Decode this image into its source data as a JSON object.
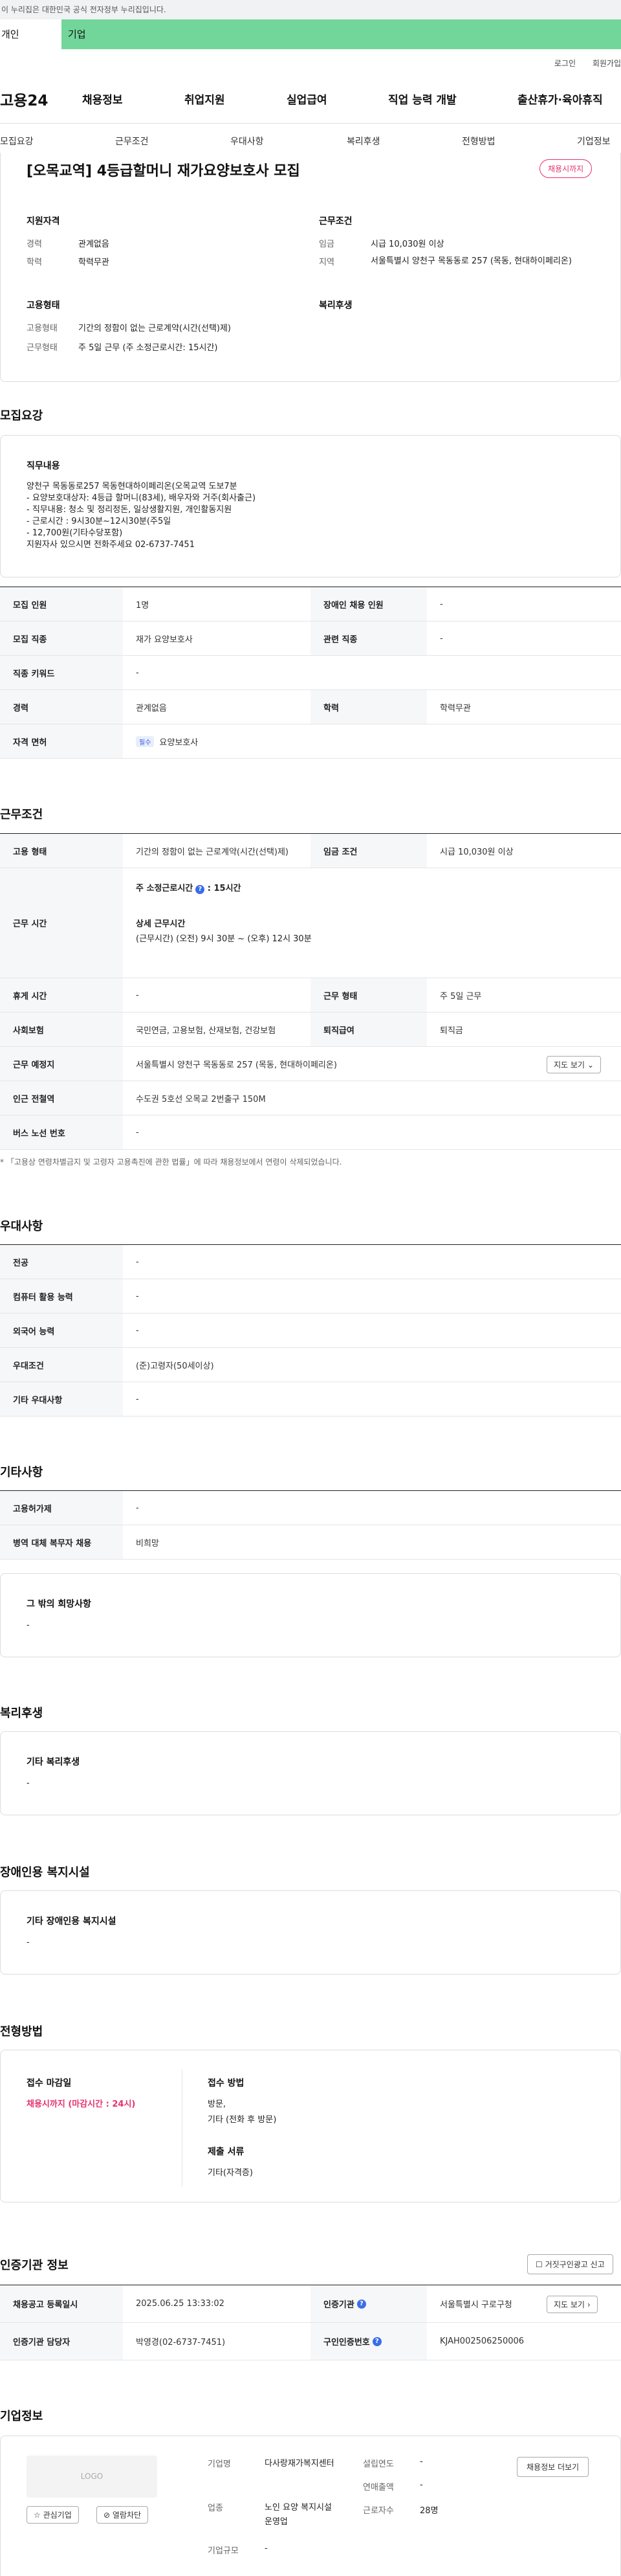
{
  "gov_banner": "이 누리집은 대한민국 공식 전자정부 누리집입니다.",
  "user_tabs": {
    "individual": "개인",
    "corporate": "기업"
  },
  "util": {
    "login": "로그인",
    "signup": "회원가입"
  },
  "gnb": {
    "logo": "고용24",
    "menu": [
      "채용정보",
      "취업지원",
      "실업급여",
      "직업 능력 개발",
      "출산휴가·육아휴직"
    ]
  },
  "anchor_nav": [
    "모집요강",
    "근무조건",
    "우대사항",
    "복리후생",
    "전형방법",
    "기업정보"
  ],
  "job": {
    "title": "[오목교역] 4등급할머니 재가요양보호사 모집",
    "status_badge": "채용시까지",
    "qual_title": "지원자격",
    "qual": [
      {
        "label": "경력",
        "value": "관계없음"
      },
      {
        "label": "학력",
        "value": "학력무관"
      }
    ],
    "cond_title": "근무조건",
    "cond": [
      {
        "label": "임금",
        "value": "시급 10,030원 이상"
      },
      {
        "label": "지역",
        "value": "서울특별시 양천구 목동동로 257 (목동, 현대하이페리온)"
      }
    ],
    "emp_title": "고용형태",
    "emp": [
      {
        "label": "고용형태",
        "value": "기간의 정함이 없는 근로계약(시간(선택)제)"
      },
      {
        "label": "근무형태",
        "value": "주 5일 근무 (주 소정근로시간: 15시간)"
      }
    ],
    "welfare_title": "복리후생"
  },
  "recruit": {
    "section_title": "모집요강",
    "duty_title": "직무내용",
    "duty_lines": [
      "양천구 목동동로257 목동현대하이페리온(오목교역 도보7분",
      "- 요양보호대상자: 4등급 할머니(83세), 배우자와 거주(회사출근)",
      "- 직무내용: 청소 및 정리정돈, 일상생활지원, 개인활동지원",
      "- 근로시간 : 9시30분~12시30분(주5일",
      "- 12,700원(기타수당포함)",
      "지원자사 있으시면 전화주세요 02-6737-7451"
    ],
    "rows": [
      {
        "h1": "모집 인원",
        "v1": "1명",
        "h2": "장애인 채용 인원",
        "v2": "-"
      },
      {
        "h1": "모집 직종",
        "v1": "재가 요양보호사",
        "h2": "관련 직종",
        "v2": "-"
      },
      {
        "h1": "직종 키워드",
        "v1": "-"
      },
      {
        "h1": "경력",
        "v1": "관계없음",
        "h2": "학력",
        "v2": "학력무관"
      },
      {
        "h1": "자격 면허",
        "tag": "필수",
        "v1": "요양보호사"
      }
    ]
  },
  "work": {
    "section_title": "근무조건",
    "emp_type_h": "고용 형태",
    "emp_type_v": "기간의 정함이 없는 근로계약(시간(선택)제)",
    "wage_h": "임금 조건",
    "wage_v": "시급 10,030원 이상",
    "hours_h": "근무 시간",
    "hours_week": "주 소정근로시간",
    "hours_week_v": ": 15시간",
    "hours_detail_h": "상세 근무시간",
    "hours_detail_v": "(근무시간) (오전) 9시 30분 ~ (오후) 12시 30분",
    "rest_h": "휴게 시간",
    "rest_v": "-",
    "shift_h": "근무 형태",
    "shift_v": "주 5일 근무",
    "ins_h": "사회보험",
    "ins_v": "국민연금, 고용보험, 산재보험, 건강보험",
    "retire_h": "퇴직급여",
    "retire_v": "퇴직금",
    "place_h": "근무 예정지",
    "place_v": "서울특별시 양천구 목동동로 257 (목동, 현대하이페리온)",
    "map_btn": "지도 보기",
    "subway_h": "인근 전철역",
    "subway_v": "수도권 5호선 오목교 2번출구 150M",
    "bus_h": "버스 노선 번호",
    "bus_v": "-",
    "note": "* 「고용상 연령차별금지 및 고령자 고용촉진에 관한 법률」에 따라 채용정보에서 연령이 삭제되었습니다."
  },
  "pref": {
    "section_title": "우대사항",
    "rows": [
      {
        "h": "전공",
        "v": "-"
      },
      {
        "h": "컴퓨터 활용 능력",
        "v": "-"
      },
      {
        "h": "외국어 능력",
        "v": "-"
      },
      {
        "h": "우대조건",
        "v": "(준)고령자(50세이상)"
      },
      {
        "h": "기타 우대사항",
        "v": "-"
      }
    ]
  },
  "etc": {
    "section_title": "기타사항",
    "rows": [
      {
        "h": "고용허가제",
        "v": "-"
      },
      {
        "h": "병역 대체 복무자 채용",
        "v": "비희망"
      }
    ],
    "box_title": "그 밖의 희망사항",
    "box_v": "-"
  },
  "welfare": {
    "section_title": "복리후생",
    "box_title": "기타 복리후생",
    "box_v": "-"
  },
  "disab": {
    "section_title": "장애인용 복지시설",
    "box_title": "기타 장애인용 복지시설",
    "box_v": "-"
  },
  "screen": {
    "section_title": "전형방법",
    "deadline_title": "접수 마감일",
    "deadline_v": "채용시까지 (마감시간 : 24시)",
    "method_title": "접수 방법",
    "method_v1": "방문,",
    "method_v2": "기타 (전화 후 방문)",
    "docs_title": "제출 서류",
    "docs_v": "기타(자격증)"
  },
  "cert": {
    "section_title": "인증기관 정보",
    "report_btn": "거짓구인광고 신고",
    "reg_h": "채용공고 등록일시",
    "reg_v": "2025.06.25 13:33:02",
    "agency_h": "인증기관",
    "agency_v": "서울특별시 구로구청",
    "map_btn": "지도 보기",
    "manager_h": "인증기관 담당자",
    "manager_v": "박영경(02-6737-7451)",
    "cert_no_h": "구인인증번호",
    "cert_no_v": "KJAH002506250006"
  },
  "company": {
    "section_title": "기업정보",
    "logo": "LOGO",
    "fav_btn": "관심기업",
    "block_btn": "열람차단",
    "name_h": "기업명",
    "name_v": "다사랑재가복지센터",
    "found_h": "설립연도",
    "found_v": "-",
    "sales_h": "연매출액",
    "sales_v": "-",
    "biz_h": "업종",
    "biz_v": "노인 요양 복지시설 운영업",
    "emp_h": "근로자수",
    "emp_v": "28명",
    "size_h": "기업규모",
    "size_v": "-",
    "jobs_btn": "채용정보 더보기"
  }
}
